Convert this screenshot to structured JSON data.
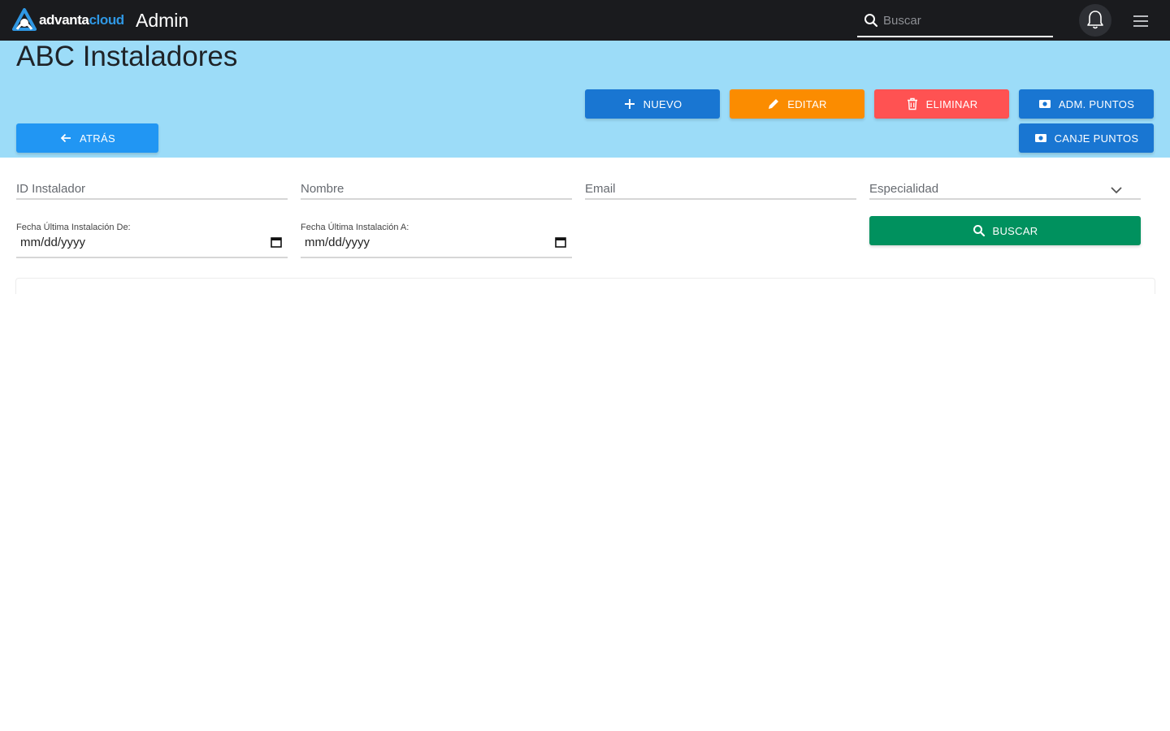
{
  "app": {
    "brand_part1": "advanta",
    "brand_part2": "cloud",
    "title": "Admin"
  },
  "header": {
    "search_placeholder": "Buscar"
  },
  "page": {
    "title": "ABC Instaladores"
  },
  "actions": {
    "nuevo": "NUEVO",
    "editar": "EDITAR",
    "eliminar": "ELIMINAR",
    "adm_puntos": "ADM. PUNTOS",
    "canje_puntos": "CANJE PUNTOS",
    "atras": "ATRÁS"
  },
  "filters": {
    "id_instalador": "ID Instalador",
    "nombre": "Nombre",
    "email": "Email",
    "especialidad": "Especialidad",
    "fecha_de_label": "Fecha Última Instalación De:",
    "fecha_de_value": "mm/dd/yyyy",
    "fecha_a_label": "Fecha Última Instalación A:",
    "fecha_a_value": "mm/dd/yyyy",
    "buscar": "BUSCAR"
  },
  "colors": {
    "topbar": "#1a1b1e",
    "band": "#9cdcf8",
    "primary": "#1976d2",
    "warning": "#fb8c00",
    "danger": "#ff5252",
    "info": "#2196f3",
    "success": "#00915e"
  }
}
